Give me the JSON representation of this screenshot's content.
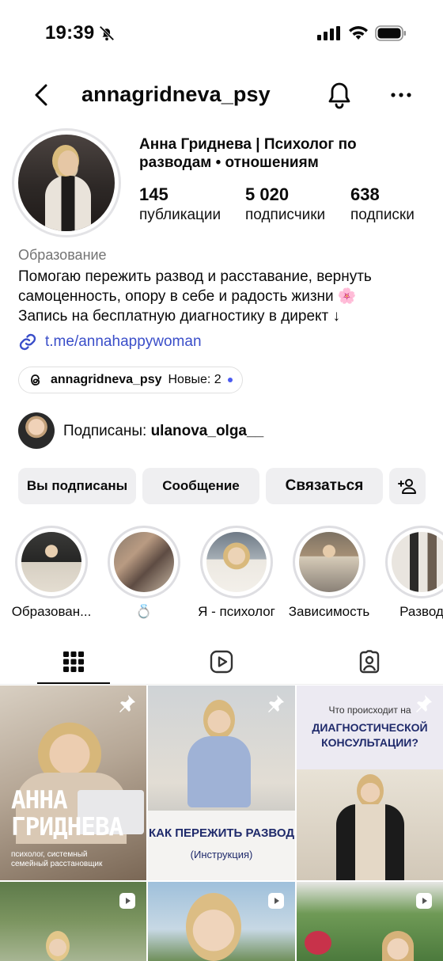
{
  "status_bar": {
    "time": "19:39"
  },
  "header": {
    "username": "annagridneva_psy"
  },
  "profile": {
    "name_line1": "Анна Гриднева | Психолог по",
    "name_line2": "разводам • отношениям",
    "stats": [
      {
        "value": "145",
        "label": "публикации"
      },
      {
        "value": "5 020",
        "label": "подписчики"
      },
      {
        "value": "638",
        "label": "подписки"
      }
    ]
  },
  "bio": {
    "category": "Образование",
    "line1": "Помогаю пережить развод и расставание, вернуть",
    "line2": "самоценность, опору в себе и радость жизни 🌸",
    "line3": "Запись на бесплатную диагностику в директ ↓",
    "link": "t.me/annahappywoman"
  },
  "threads": {
    "username": "annagridneva_psy",
    "new_label": "Новые: 2"
  },
  "followed_by": {
    "prefix": "Подписаны: ",
    "user": "ulanova_olga__"
  },
  "actions": {
    "following": "Вы подписаны",
    "message": "Сообщение",
    "contact": "Связаться"
  },
  "highlights": [
    {
      "label": "Образован..."
    },
    {
      "label": "💍"
    },
    {
      "label": "Я - психолог"
    },
    {
      "label": "Зависимость"
    },
    {
      "label": "Развод"
    }
  ],
  "posts": [
    {
      "title_line1": "АННА",
      "title_line2": "ГРИДНЕВА",
      "caption_line1": "психолог, системный",
      "caption_line2": "семейный расстановщик",
      "pinned": true
    },
    {
      "title": "КАК ПЕРЕЖИТЬ РАЗВОД",
      "subtitle": "(Инструкция)",
      "pinned": true
    },
    {
      "pre": "Что происходит на",
      "title_line1": "ДИАГНОСТИЧЕСКОЙ",
      "title_line2": "КОНСУЛЬТАЦИИ?",
      "pinned": true
    },
    {
      "type": "reel"
    },
    {
      "type": "reel"
    },
    {
      "type": "reel"
    }
  ],
  "colors": {
    "link": "#3a4ec9",
    "button_bg": "#efeff1",
    "threads_dot": "#4b5bf0",
    "post_navy": "#1f2a6b"
  }
}
